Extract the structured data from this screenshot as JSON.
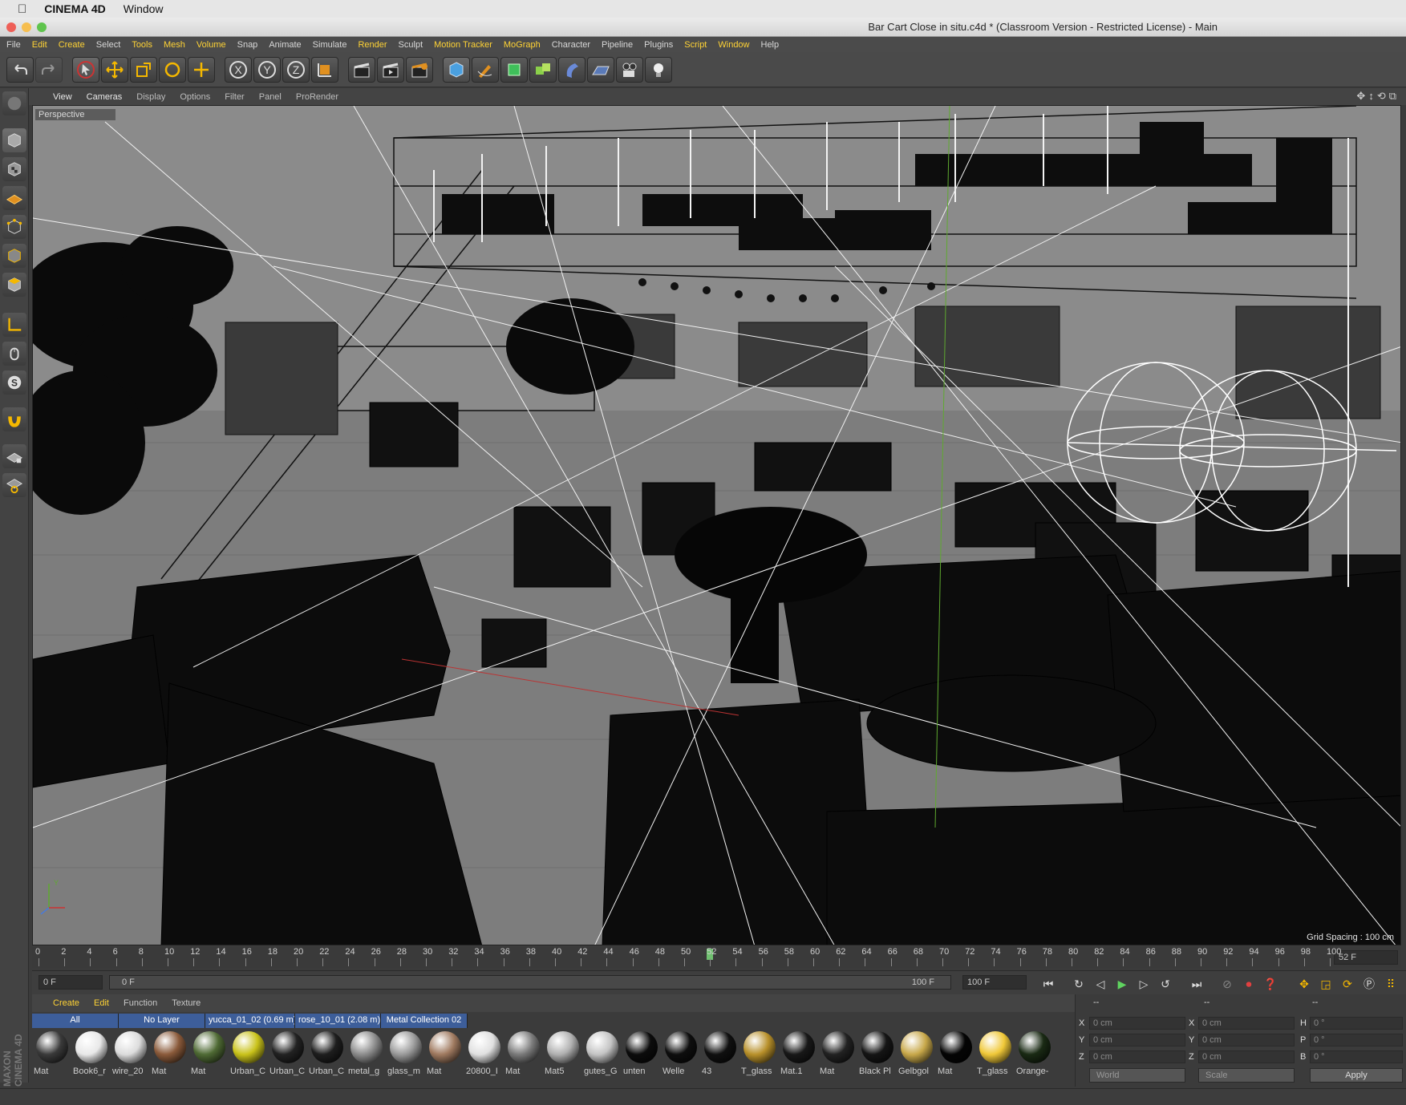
{
  "mac": {
    "apple": "",
    "app": "CINEMA 4D",
    "menu": "Window"
  },
  "window": {
    "title": "Bar Cart Close in situ.c4d * (Classroom Version - Restricted License) - Main"
  },
  "menubar": [
    {
      "label": "File",
      "hl": false
    },
    {
      "label": "Edit",
      "hl": true
    },
    {
      "label": "Create",
      "hl": true
    },
    {
      "label": "Select",
      "hl": false
    },
    {
      "label": "Tools",
      "hl": true
    },
    {
      "label": "Mesh",
      "hl": true
    },
    {
      "label": "Volume",
      "hl": true
    },
    {
      "label": "Snap",
      "hl": false
    },
    {
      "label": "Animate",
      "hl": false
    },
    {
      "label": "Simulate",
      "hl": false
    },
    {
      "label": "Render",
      "hl": true
    },
    {
      "label": "Sculpt",
      "hl": false
    },
    {
      "label": "Motion Tracker",
      "hl": true
    },
    {
      "label": "MoGraph",
      "hl": true
    },
    {
      "label": "Character",
      "hl": false
    },
    {
      "label": "Pipeline",
      "hl": false
    },
    {
      "label": "Plugins",
      "hl": false
    },
    {
      "label": "Script",
      "hl": true
    },
    {
      "label": "Window",
      "hl": true
    },
    {
      "label": "Help",
      "hl": false
    }
  ],
  "viewport_menu": [
    {
      "label": "View",
      "act": true
    },
    {
      "label": "Cameras",
      "act": true
    },
    {
      "label": "Display",
      "act": false
    },
    {
      "label": "Options",
      "act": false
    },
    {
      "label": "Filter",
      "act": false
    },
    {
      "label": "Panel",
      "act": false
    },
    {
      "label": "ProRender",
      "act": false
    }
  ],
  "viewport": {
    "label": "Perspective",
    "grid_spacing": "Grid Spacing : 100 cm",
    "axis_y": "Y"
  },
  "timeline": {
    "ticks": [
      "0",
      "2",
      "4",
      "6",
      "8",
      "10",
      "12",
      "14",
      "16",
      "18",
      "20",
      "22",
      "24",
      "26",
      "28",
      "30",
      "32",
      "34",
      "36",
      "38",
      "40",
      "42",
      "44",
      "46",
      "48",
      "50",
      "52",
      "54",
      "56",
      "58",
      "60",
      "62",
      "64",
      "66",
      "68",
      "70",
      "72",
      "74",
      "76",
      "78",
      "80",
      "82",
      "84",
      "86",
      "88",
      "90",
      "92",
      "94",
      "96",
      "98",
      "100"
    ],
    "current": "52",
    "current_field": "52 F"
  },
  "playback": {
    "start": "0 F",
    "range_start": "0 F",
    "range_end": "100 F",
    "end": "100 F"
  },
  "material_manager": {
    "menu": [
      {
        "label": "Create",
        "y": true
      },
      {
        "label": "Edit",
        "y": true
      },
      {
        "label": "Function",
        "y": false
      },
      {
        "label": "Texture",
        "y": false
      }
    ],
    "layers": [
      "All",
      "No Layer",
      "yucca_01_02 (0.69 m)",
      "rose_10_01 (2.08 m)",
      "Metal Collection 02"
    ],
    "materials": [
      {
        "name": "Mat",
        "color": "#3a3a3a"
      },
      {
        "name": "Book6_r",
        "color": "#e8e8e8"
      },
      {
        "name": "wire_20",
        "color": "#dcdcdc"
      },
      {
        "name": "Mat",
        "color": "#8a5a3a"
      },
      {
        "name": "Mat",
        "color": "#4f6a34"
      },
      {
        "name": "Urban_C",
        "color": "#c9c21a"
      },
      {
        "name": "Urban_C",
        "color": "#222222"
      },
      {
        "name": "Urban_C",
        "color": "#1e1e1e"
      },
      {
        "name": "metal_g",
        "color": "#8c8c8c"
      },
      {
        "name": "glass_m",
        "color": "#9a9a9a"
      },
      {
        "name": "Mat",
        "color": "#a07a60"
      },
      {
        "name": "20800_I",
        "color": "#e0e0e0"
      },
      {
        "name": "Mat",
        "color": "#7a7a7a"
      },
      {
        "name": "Mat5",
        "color": "#b0b0b0"
      },
      {
        "name": "gutes_G",
        "color": "#c4c4c4"
      },
      {
        "name": "unten",
        "color": "#0c0c0c"
      },
      {
        "name": "Welle",
        "color": "#0e0e0e"
      },
      {
        "name": "43",
        "color": "#101010"
      },
      {
        "name": "T_glass",
        "color": "#b8902a"
      },
      {
        "name": "Mat.1",
        "color": "#181818"
      },
      {
        "name": "Mat",
        "color": "#222222"
      },
      {
        "name": "Black Pl",
        "color": "#151515"
      },
      {
        "name": "Gelbgol",
        "color": "#c8a84a"
      },
      {
        "name": "Mat",
        "color": "#050505"
      },
      {
        "name": "T_glass",
        "color": "#f0c838"
      },
      {
        "name": "Orange-",
        "color": "#1a2a14"
      }
    ]
  },
  "coordinates": {
    "pos": {
      "x": "0 cm",
      "y": "0 cm",
      "z": "0 cm"
    },
    "size": {
      "x": "0 cm",
      "y": "0 cm",
      "z": "0 cm"
    },
    "rot": {
      "h": "0 °",
      "p": "0 °",
      "b": "0 °"
    },
    "labels": {
      "x": "X",
      "y": "Y",
      "z": "Z",
      "h": "H",
      "p": "P",
      "b": "B"
    },
    "dash1": "--",
    "dash2": "--",
    "dash3": "--",
    "world": "World",
    "scale": "Scale",
    "apply": "Apply"
  },
  "branding": "MAXON CINEMA 4D",
  "colors": {
    "accent": "#ffd335",
    "viewport_bg": "#8a8a8a",
    "panel": "#3b3b3b"
  }
}
